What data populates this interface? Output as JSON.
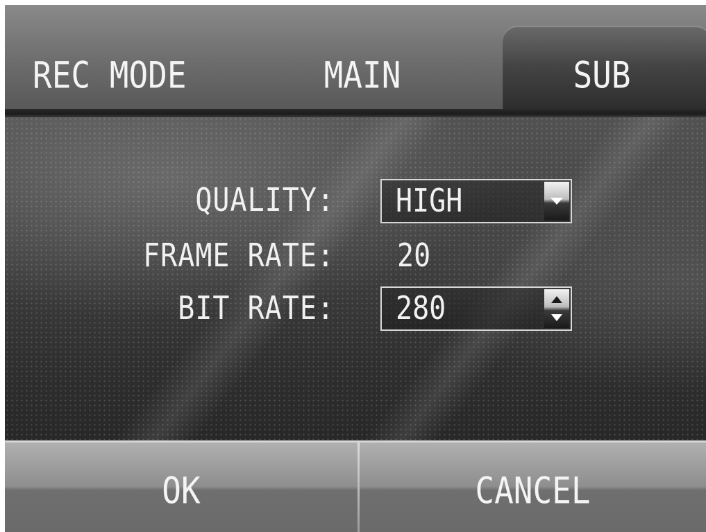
{
  "tabs": {
    "title": "REC MODE",
    "main_label": "MAIN",
    "sub_label": "SUB",
    "active": "SUB"
  },
  "form": {
    "quality": {
      "label": "QUALITY:",
      "value": "HIGH",
      "control_icon": "chevron-down-icon"
    },
    "frame_rate": {
      "label": "FRAME RATE:",
      "value": "20"
    },
    "bit_rate": {
      "label": "BIT RATE:",
      "value": "280",
      "control_icon": "up-down-spinner-icon"
    }
  },
  "buttons": {
    "ok_label": "OK",
    "cancel_label": "CANCEL"
  },
  "colors": {
    "text": "#f1f1f1",
    "field_border": "#d8d8d8",
    "background": "#3a3a3a"
  }
}
